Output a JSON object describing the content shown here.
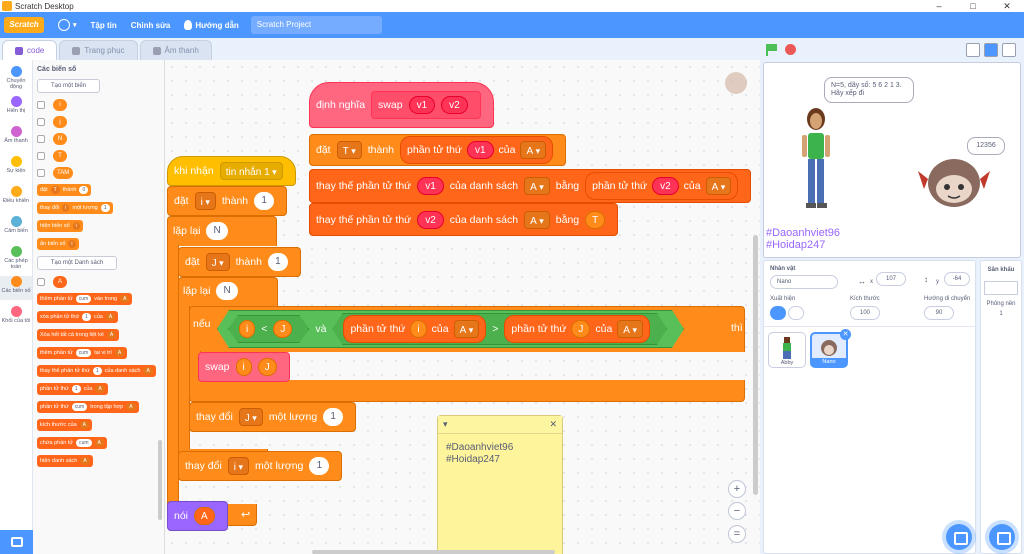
{
  "window": {
    "title": "Scratch Desktop",
    "controls": [
      "–",
      "□",
      "✕"
    ]
  },
  "menubar": {
    "logo": "Scratch",
    "file": "Tập tin",
    "edit": "Chỉnh sửa",
    "tutorials": "Hướng dẫn",
    "project_title": "Scratch Project"
  },
  "tabs": {
    "code": "code",
    "costumes": "Trang phục",
    "sounds": "Âm thanh"
  },
  "categories": [
    {
      "label": "Chuyển động",
      "color": "#4c97ff"
    },
    {
      "label": "Hiển thị",
      "color": "#9966ff"
    },
    {
      "label": "Âm thanh",
      "color": "#cf63cf"
    },
    {
      "label": "Sự kiện",
      "color": "#ffbf00"
    },
    {
      "label": "Điều khiển",
      "color": "#ffab19"
    },
    {
      "label": "Cảm biến",
      "color": "#5cb1d6"
    },
    {
      "label": "Các phép toán",
      "color": "#59c059"
    },
    {
      "label": "Các biến số",
      "color": "#ff8c1a"
    },
    {
      "label": "Khối của tôi",
      "color": "#ff6680"
    }
  ],
  "palette": {
    "heading": "Các biến số",
    "make_var": "Tạo một biến",
    "vars": [
      "i",
      "j",
      "N",
      "T",
      "TAM"
    ],
    "set_block": {
      "verb": "đặt",
      "var": "T",
      "mid": "thành",
      "val": "0"
    },
    "change_block": {
      "verb": "thay đổi",
      "var": "i",
      "mid": "một lượng",
      "val": "1"
    },
    "show_block": {
      "verb": "hiện biến số",
      "var": "i"
    },
    "hide_block": {
      "verb": "ẩn biến số",
      "var": "i"
    },
    "make_list": "Tạo một Danh sách",
    "list_var": "A",
    "list_blocks": [
      {
        "text": "thêm phần tử",
        "in1": "cum",
        "mid": "vào trong",
        "dd": "A"
      },
      {
        "text": "xóa phần tử thứ",
        "in1": "1",
        "mid": "của",
        "dd": "A"
      },
      {
        "text": "Xóa hết tất cả trong liệt kê",
        "in1": "",
        "mid": "",
        "dd": "A"
      },
      {
        "text": "thêm phần tử",
        "in1": "cum",
        "mid": "tại vị trí",
        "dd": "A"
      },
      {
        "text": "thay thế phần tử thứ",
        "in1": "1",
        "mid": "của danh sách",
        "dd": "A"
      },
      {
        "text": "phần tử thứ",
        "in1": "1",
        "mid": "của",
        "dd": "A"
      },
      {
        "text": "phần tử thứ",
        "in1": "cum",
        "mid": "trong tập hợp",
        "dd": "A"
      },
      {
        "text": "kích thước của",
        "in1": "",
        "mid": "",
        "dd": "A"
      },
      {
        "text": "chứa phần tử",
        "in1": "cum",
        "mid": "",
        "dd": "A"
      },
      {
        "text": "hiện danh sách",
        "in1": "",
        "mid": "",
        "dd": "A"
      }
    ]
  },
  "script_define": {
    "define": "định nghĩa",
    "name": "swap",
    "p1": "v1",
    "p2": "v2",
    "set1": {
      "verb": "đặt",
      "var": "T",
      "to": "thành",
      "item": "phần tử thứ",
      "idx": "v1",
      "of": "của",
      "list": "A"
    },
    "replace1": {
      "verb": "thay thế phần tử thứ",
      "idx": "v1",
      "of": "của danh sách",
      "list": "A",
      "with": "bằng",
      "item": "phần tử thứ",
      "idx2": "v2",
      "of2": "của",
      "list2": "A"
    },
    "replace2": {
      "verb": "thay thế phần tử thứ",
      "idx": "v2",
      "of": "của danh sách",
      "list": "A",
      "with": "bằng",
      "val": "T"
    }
  },
  "script_main": {
    "hat": "khi nhận",
    "msg": "tin nhắn 1",
    "set_i": {
      "verb": "đặt",
      "var": "i",
      "to": "thành",
      "val": "1"
    },
    "repeat1": {
      "verb": "lặp lại",
      "val": "N"
    },
    "set_j": {
      "verb": "đặt",
      "var": "J",
      "to": "thành",
      "val": "1"
    },
    "repeat2": {
      "verb": "lặp lại",
      "val": "N"
    },
    "if": {
      "verb": "nếu",
      "a": "i",
      "lt": "<",
      "b": "J",
      "and": "và",
      "item": "phần tử thứ",
      "idx": "i",
      "of": "của",
      "list": "A",
      "gt": ">",
      "item2": "phần tử thứ",
      "idx2": "J",
      "of2": "của",
      "list2": "A",
      "then": "thì"
    },
    "swap": {
      "name": "swap",
      "a": "i",
      "b": "J"
    },
    "change_j": {
      "verb": "thay đổi",
      "var": "J",
      "by": "một lượng",
      "val": "1"
    },
    "change_i": {
      "verb": "thay đổi",
      "var": "i",
      "by": "một lượng",
      "val": "1"
    },
    "say": {
      "verb": "nói",
      "val": "A"
    }
  },
  "note": {
    "lines": [
      "#Daoanhviet96",
      "#Hoidap247"
    ]
  },
  "zoom": {
    "in": "+",
    "out": "−",
    "reset": "="
  },
  "stage": {
    "bubble1": "N=5, dãy số: 5 6 2 1 3.\nHãy xếp đi",
    "bubble2": "12356",
    "tags": [
      "#Daoanhviet96",
      "#Hoidap247"
    ]
  },
  "sprite_info": {
    "sprite_label": "Nhân vật",
    "sprite_name": "Nano",
    "x_label": "x",
    "x": "107",
    "y_label": "y",
    "y": "-64",
    "show_label": "Xuất hiện",
    "size_label": "Kích thước",
    "size": "100",
    "dir_label": "Hướng di chuyển",
    "dir": "90"
  },
  "sprites": [
    {
      "name": "Abby"
    },
    {
      "name": "Nano"
    }
  ],
  "backdrop": {
    "label": "Sân khấu",
    "count_label": "Phông nền",
    "count": "1"
  }
}
